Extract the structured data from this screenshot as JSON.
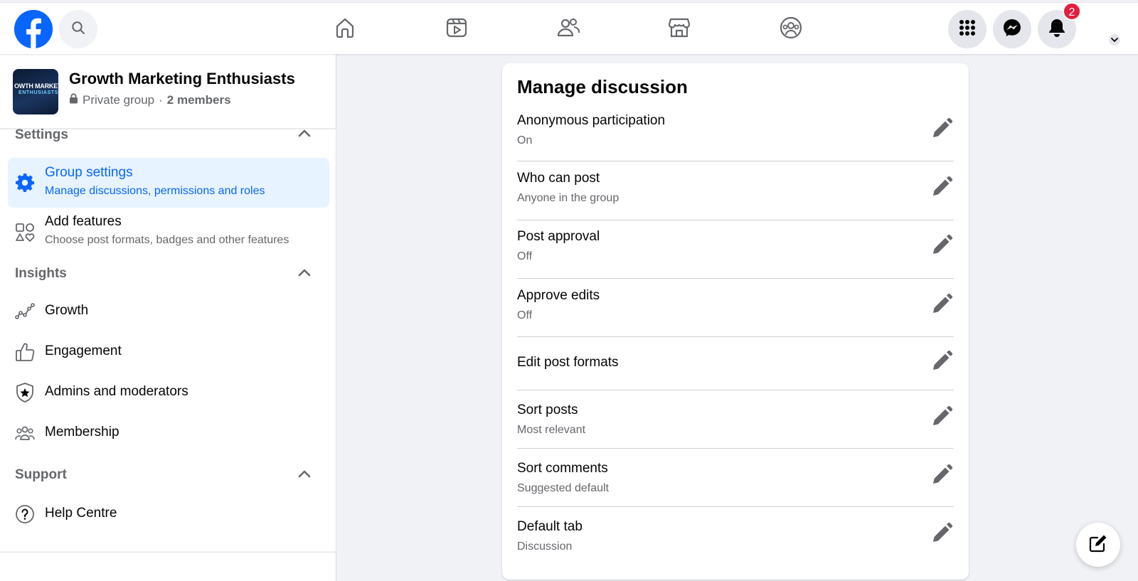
{
  "topbar": {
    "logo_icon": "facebook-logo",
    "search_icon": "search-icon",
    "nav": [
      "home-icon",
      "video-icon",
      "friends-icon",
      "marketplace-icon",
      "groups-icon"
    ],
    "right": [
      "menu-grid-icon",
      "messenger-icon",
      "bell-icon"
    ],
    "notification_count": "2",
    "brand_color": "#0866ff",
    "badge_color": "#e41e3f"
  },
  "group": {
    "thumb_line1": "OWTH MARKETI",
    "thumb_line2": "ENTHUSIASTS",
    "name": "Growth Marketing Enthusiasts",
    "privacy": "Private group",
    "separator": "·",
    "members": "2 members"
  },
  "sidebar": {
    "settings_heading": "Settings",
    "group_settings": {
      "label": "Group settings",
      "desc": "Manage discussions, permissions and roles",
      "icon": "gear-icon"
    },
    "add_features": {
      "label": "Add features",
      "desc": "Choose post formats, badges and other features",
      "icon": "shapes-icon"
    },
    "insights_heading": "Insights",
    "insights_items": [
      {
        "label": "Growth",
        "icon": "growth-chart-icon"
      },
      {
        "label": "Engagement",
        "icon": "thumbs-up-icon"
      },
      {
        "label": "Admins and moderators",
        "icon": "shield-star-icon"
      },
      {
        "label": "Membership",
        "icon": "people-group-icon"
      }
    ],
    "support_heading": "Support",
    "help": {
      "label": "Help Centre",
      "icon": "question-circle-icon"
    }
  },
  "main": {
    "title": "Manage discussion",
    "settings": [
      {
        "label": "Anonymous participation",
        "value": "On"
      },
      {
        "label": "Who can post",
        "value": "Anyone in the group"
      },
      {
        "label": "Post approval",
        "value": "Off"
      },
      {
        "label": "Approve edits",
        "value": "Off"
      },
      {
        "label": "Edit post formats",
        "value": ""
      },
      {
        "label": "Sort posts",
        "value": "Most relevant"
      },
      {
        "label": "Sort comments",
        "value": "Suggested default"
      },
      {
        "label": "Default tab",
        "value": "Discussion"
      }
    ]
  },
  "compose_icon": "compose-icon"
}
